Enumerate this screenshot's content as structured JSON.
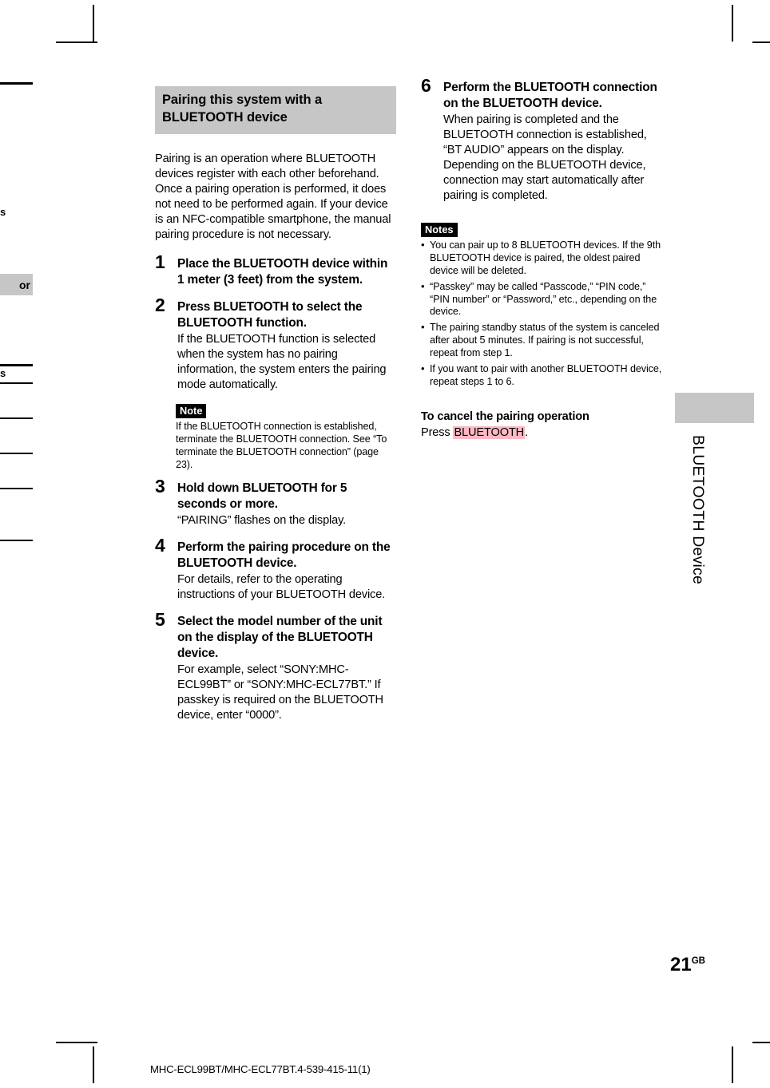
{
  "section_header": "Pairing this system with a BLUETOOTH device",
  "intro": "Pairing is an operation where BLUETOOTH devices register with each other beforehand. Once a pairing operation is performed, it does not need to be performed again. If your device is an NFC-compatible smartphone, the manual pairing procedure is not necessary.",
  "steps": [
    {
      "num": "1",
      "title": "Place the BLUETOOTH device within 1 meter (3 feet) from the system.",
      "body": ""
    },
    {
      "num": "2",
      "title": "Press BLUETOOTH to select the BLUETOOTH function.",
      "body": "If the BLUETOOTH function is selected when the system has no pairing information, the system enters the pairing mode automatically."
    },
    {
      "num": "3",
      "title": "Hold down BLUETOOTH for 5 seconds or more.",
      "body": "“PAIRING” flashes on the display."
    },
    {
      "num": "4",
      "title": "Perform the pairing procedure on the BLUETOOTH device.",
      "body": "For details, refer to the operating instructions of your BLUETOOTH device."
    },
    {
      "num": "5",
      "title": "Select the model number of the unit on the display of the BLUETOOTH device.",
      "body": "For example, select “SONY:MHC-ECL99BT” or “SONY:MHC-ECL77BT.” If passkey is required on the BLUETOOTH device, enter “0000”."
    },
    {
      "num": "6",
      "title": "Perform the BLUETOOTH connection on the BLUETOOTH device.",
      "body": "When pairing is completed and the BLUETOOTH connection is established, “BT AUDIO” appears on the display.\nDepending on the BLUETOOTH device, connection may start automatically after pairing is completed."
    }
  ],
  "note_step2": {
    "label": "Note",
    "text": "If the BLUETOOTH connection is established, terminate the BLUETOOTH connection. See “To terminate the BLUETOOTH connection” (page 23)."
  },
  "notes": {
    "label": "Notes",
    "items": [
      "You can pair up to 8 BLUETOOTH devices. If the 9th BLUETOOTH device is paired, the oldest paired device will be deleted.",
      "“Passkey” may be called “Passcode,” “PIN code,” “PIN number” or “Password,” etc., depending on the device.",
      "The pairing standby status of the system is canceled after about 5 minutes. If pairing is not successful, repeat from step 1.",
      "If you want to pair with another BLUETOOTH device, repeat steps 1 to 6."
    ]
  },
  "cancel_section": {
    "heading": "To cancel the pairing operation",
    "press_prefix": "Press ",
    "key": "BLUETOOTH",
    "press_suffix": "."
  },
  "side_tab_label": "BLUETOOTH Device",
  "folio": {
    "number": "21",
    "suffix": "GB"
  },
  "footer": "MHC-ECL99BT/MHC-ECL77BT.4-539-415-11(1)",
  "bleed": {
    "letter_top": "s",
    "tab_label": "or",
    "letter_lower": "s"
  },
  "colors": {
    "header_gray": "#c6c6c6",
    "highlight_pink": "#fcb9c4",
    "ink": "#000000"
  }
}
